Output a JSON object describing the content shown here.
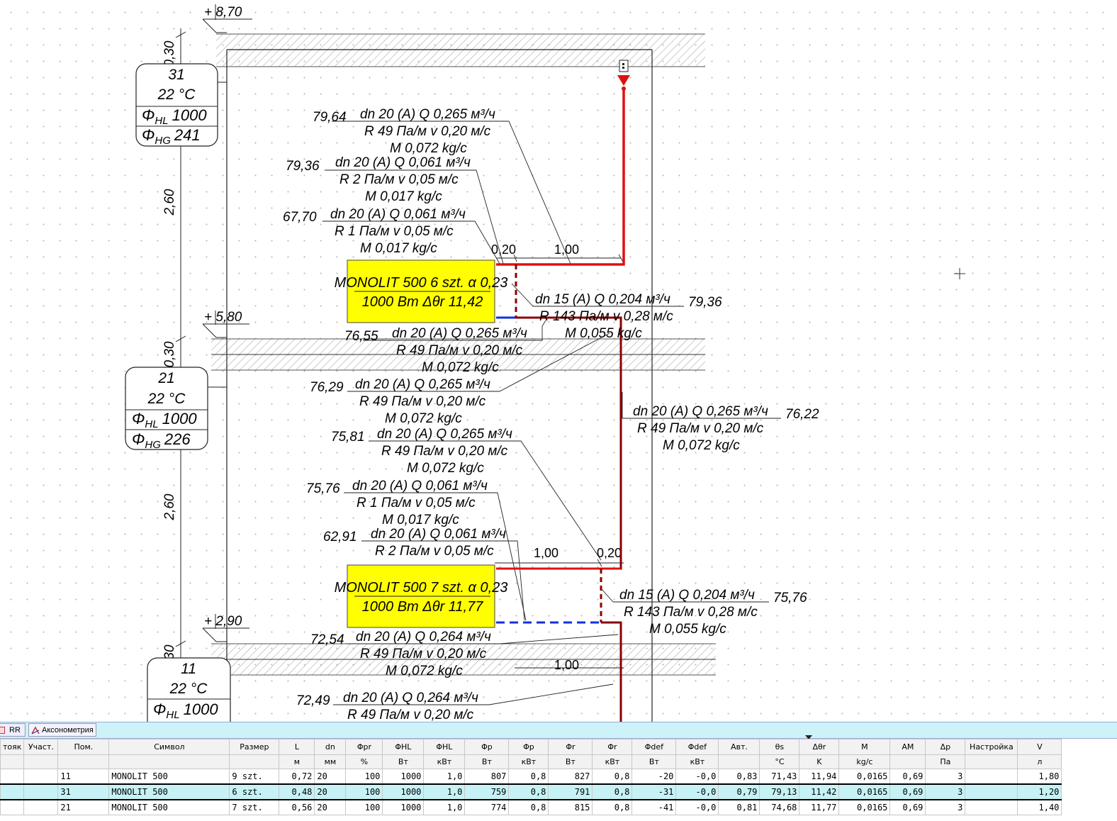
{
  "levels": [
    {
      "id": "top",
      "label": "+ 8,70"
    },
    {
      "id": "mid",
      "label": "+ 5,80"
    },
    {
      "id": "low",
      "label": "+ 2,90"
    }
  ],
  "dims": {
    "d1": "0,30",
    "d2": "2,60",
    "d3": "0,30",
    "d4": "2,60",
    "d5": "30"
  },
  "rooms": [
    {
      "number": "31",
      "temp": "22 °C",
      "hl_sym": "Φ",
      "hl_sub": "HL",
      "hl_val": "1000",
      "hg_sym": "Φ",
      "hg_sub": "HG",
      "hg_val": "241"
    },
    {
      "number": "21",
      "temp": "22 °C",
      "hl_sym": "Φ",
      "hl_sub": "HL",
      "hl_val": "1000",
      "hg_sym": "Φ",
      "hg_sub": "HG",
      "hg_val": "226"
    },
    {
      "number": "11",
      "temp": "22 °C",
      "hl_sym": "Φ",
      "hl_sub": "HL",
      "hl_val": "1000"
    }
  ],
  "radiators": [
    {
      "line1": "MONOLIT 500 6 szt. α 0,23",
      "line2": "1000 Вт Δθr 11,42"
    },
    {
      "line1": "MONOLIT 500 7 szt. α 0,23",
      "line2": "1000 Вт Δθr 11,77"
    }
  ],
  "pipe_labels": [
    {
      "temp": "79,64",
      "l1": "dn 20 (A) Q 0,265 м³/ч",
      "l2": "R 49 Па/м v 0,20 м/с",
      "l3": "M 0,072 kg/c"
    },
    {
      "temp": "79,36",
      "l1": "dn 20 (A) Q 0,061 м³/ч",
      "l2": "R 2 Па/м v 0,05 м/с",
      "l3": "M 0,017 kg/c"
    },
    {
      "temp": "67,70",
      "l1": "dn 20 (A) Q 0,061 м³/ч",
      "l2": "R 1 Па/м v 0,05 м/с",
      "l3": "M 0,017 kg/c"
    },
    {
      "temp": "79,36",
      "l1": "dn 15 (A) Q 0,204 м³/ч",
      "l2": "R 143 Па/м v 0,28 м/с",
      "l3": "M 0,055 kg/c"
    },
    {
      "temp": "76,55",
      "l1": "dn 20 (A) Q 0,265 м³/ч",
      "l2": "R 49 Па/м v 0,20 м/с",
      "l3": "M 0,072 kg/c"
    },
    {
      "temp": "76,29",
      "l1": "dn 20 (A) Q 0,265 м³/ч",
      "l2": "R 49 Па/м v 0,20 м/с",
      "l3": "M 0,072 kg/c"
    },
    {
      "temp": "76,22",
      "l1": "dn 20 (A) Q 0,265 м³/ч",
      "l2": "R 49 Па/м v 0,20 м/с",
      "l3": "M 0,072 kg/c"
    },
    {
      "temp": "75,81",
      "l1": "dn 20 (A) Q 0,265 м³/ч",
      "l2": "R 49 Па/м v 0,20 м/с",
      "l3": "M 0,072 kg/c"
    },
    {
      "temp": "75,76",
      "l1": "dn 20 (A) Q 0,061 м³/ч",
      "l2": "R 1 Па/м v 0,05 м/с",
      "l3": "M 0,017 kg/c"
    },
    {
      "temp": "62,91",
      "l1": "dn 20 (A) Q 0,061 м³/ч",
      "l2": "R 2 Па/м v 0,05 м/с",
      "l3": ""
    },
    {
      "temp": "75,76",
      "l1": "dn 15 (A) Q 0,204 м³/ч",
      "l2": "R 143 Па/м v 0,28 м/с",
      "l3": "M 0,055 kg/c"
    },
    {
      "temp": "72,54",
      "l1": "dn 20 (A) Q 0,264 м³/ч",
      "l2": "R 49 Па/м v 0,20 м/с",
      "l3": "M 0,072 kg/c"
    },
    {
      "temp": "72,49",
      "l1": "dn 20 (A) Q 0,264 м³/ч",
      "l2": "R 49 Па/м v 0,20 м/с",
      "l3": ""
    }
  ],
  "length_labels": {
    "a": "0,20",
    "b": "1,00",
    "c": "1,00",
    "d": "0,20",
    "e": "1,00"
  },
  "colors": {
    "supply": "#e01010",
    "return": "#1030e0",
    "riser": "#8b0000",
    "radiator": "#ffff00"
  },
  "tabs": [
    {
      "label": "RR 1",
      "icon": "plan-view-icon"
    },
    {
      "label": "Аксонометрия",
      "icon": "axonometry-icon"
    }
  ],
  "table": {
    "headers": [
      "тояк",
      "Участ.",
      "Пом.",
      "Символ",
      "Размер",
      "L",
      "dn",
      "Φpr",
      "ΦHL",
      "ΦHL",
      "Φp",
      "Φp",
      "Φr",
      "Φr",
      "Φdef",
      "Φdef",
      "Авт.",
      "θs",
      "Δθr",
      "M",
      "AM",
      "Δp",
      "Настройка",
      "V"
    ],
    "units": [
      "",
      "",
      "",
      "",
      "",
      "м",
      "мм",
      "%",
      "Вт",
      "кВт",
      "Вт",
      "кВт",
      "Вт",
      "кВт",
      "Вт",
      "кВт",
      "",
      "°C",
      "K",
      "kg/c",
      "",
      "Па",
      "",
      "л"
    ],
    "rows": [
      [
        "",
        "",
        "11",
        "MONOLIT 500",
        "9 szt.",
        "0,72",
        "20",
        "100",
        "1000",
        "1,0",
        "807",
        "0,8",
        "827",
        "0,8",
        "-20",
        "-0,0",
        "0,83",
        "71,43",
        "11,94",
        "0,0165",
        "0,69",
        "3",
        "",
        "1,80"
      ],
      [
        "",
        "",
        "31",
        "MONOLIT 500",
        "6 szt.",
        "0,48",
        "20",
        "100",
        "1000",
        "1,0",
        "759",
        "0,8",
        "791",
        "0,8",
        "-31",
        "-0,0",
        "0,79",
        "79,13",
        "11,42",
        "0,0165",
        "0,69",
        "3",
        "",
        "1,20"
      ],
      [
        "",
        "",
        "21",
        "MONOLIT 500",
        "7 szt.",
        "0,56",
        "20",
        "100",
        "1000",
        "1,0",
        "774",
        "0,8",
        "815",
        "0,8",
        "-41",
        "-0,0",
        "0,81",
        "74,68",
        "11,77",
        "0,0165",
        "0,69",
        "3",
        "",
        "1,40"
      ]
    ]
  }
}
